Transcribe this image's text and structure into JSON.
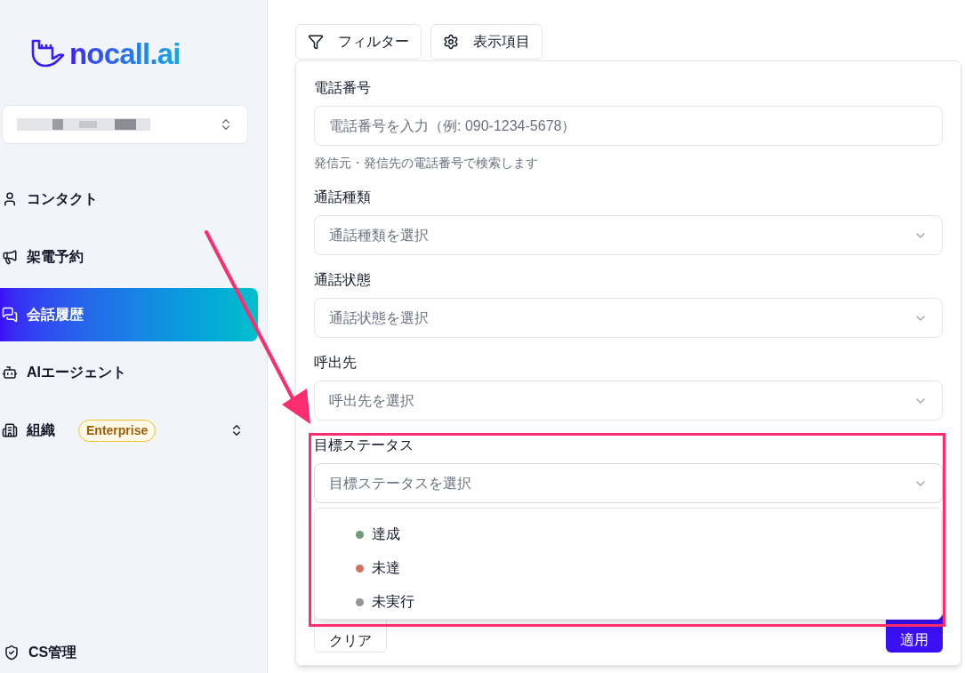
{
  "logo": {
    "text": "nocall.ai"
  },
  "sidebar": {
    "items": [
      {
        "label": "コンタクト",
        "selected": false
      },
      {
        "label": "架電予約",
        "selected": false
      },
      {
        "label": "会話履歴",
        "selected": true
      },
      {
        "label": "AIエージェント",
        "selected": false
      },
      {
        "label": "組織",
        "selected": false,
        "badge": "Enterprise"
      }
    ],
    "footer_item": {
      "label": "CS管理"
    }
  },
  "toolbar": {
    "buttons": [
      {
        "label": "フィルター"
      },
      {
        "label": "表示項目"
      }
    ]
  },
  "filter_panel": {
    "fields": [
      {
        "label": "電話番号",
        "kind": "input",
        "placeholder": "電話番号を入力（例: 090-1234-5678）",
        "hint": "発信元・発信先の電話番号で検索します"
      },
      {
        "label": "通話種類",
        "kind": "select",
        "placeholder": "通話種類を選択"
      },
      {
        "label": "通話状態",
        "kind": "select",
        "placeholder": "通話状態を選択"
      },
      {
        "label": "呼出先",
        "kind": "select",
        "placeholder": "呼出先を選択"
      },
      {
        "label": "目標ステータス",
        "kind": "select",
        "placeholder": "目標ステータスを選択",
        "highlighted": true,
        "expanded": true,
        "options": [
          {
            "label": "達成",
            "color": "#739a7b"
          },
          {
            "label": "未達",
            "color": "#d07566"
          },
          {
            "label": "未実行",
            "color": "#959591"
          }
        ]
      }
    ],
    "buttons": [
      {
        "label": "クリア",
        "kind": "secondary"
      },
      {
        "label": "適用",
        "kind": "primary"
      }
    ]
  }
}
